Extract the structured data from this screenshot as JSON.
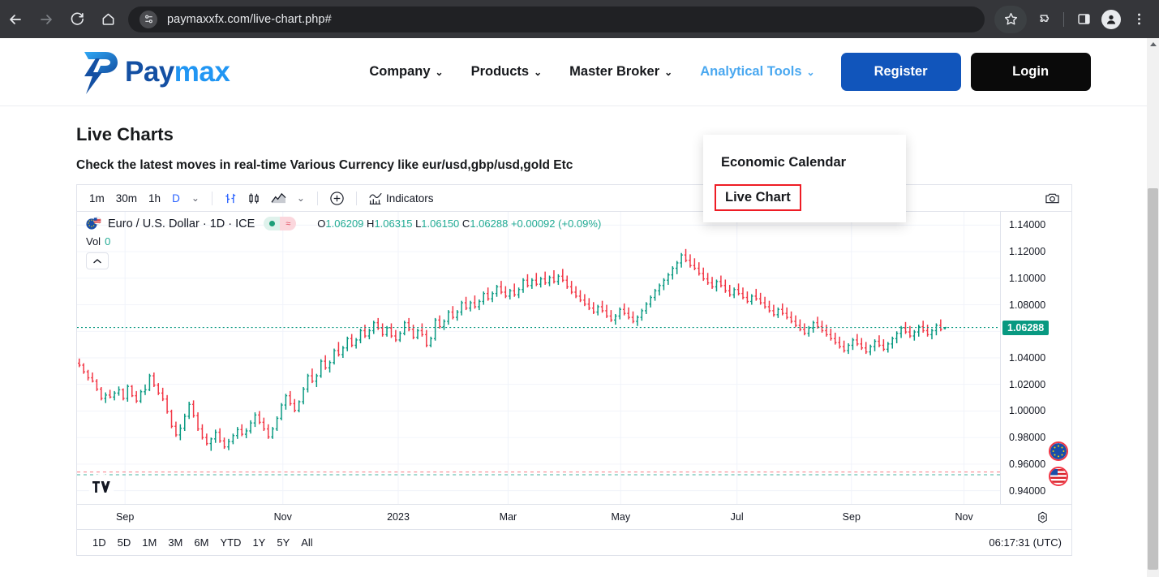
{
  "browser": {
    "back_icon": "back-arrow-icon",
    "forward_icon": "forward-arrow-icon",
    "reload_icon": "reload-icon",
    "home_icon": "home-icon",
    "site_info_icon": "site-settings-icon",
    "url": "paymaxxfx.com/live-chart.php#",
    "bookmark_icon": "star-icon",
    "extensions_icon": "extensions-puzzle-icon",
    "sidepanel_icon": "side-panel-icon",
    "profile_icon": "profile-avatar-icon",
    "menu_icon": "three-dot-menu-icon"
  },
  "site": {
    "logo": {
      "part1": "Pay",
      "part2": "max",
      "mark": "p-lightning-bolt-logo"
    },
    "nav": [
      {
        "label": "Company",
        "active": false
      },
      {
        "label": "Products",
        "active": false
      },
      {
        "label": "Master Broker",
        "active": false
      },
      {
        "label": "Analytical Tools",
        "active": true
      }
    ],
    "caret": "⌄",
    "register_label": "Register",
    "login_label": "Login",
    "register_color": "#1155bb",
    "login_color": "#0a0a0a",
    "active_nav_color": "#4aa8f0"
  },
  "dropdown": {
    "items": [
      {
        "label": "Economic Calendar",
        "highlighted": false
      },
      {
        "label": "Live Chart",
        "highlighted": true
      }
    ],
    "highlight_color": "#ee1c25"
  },
  "page": {
    "title": "Live Charts",
    "subtitle": "Check the latest moves in real-time Various Currency like eur/usd,gbp/usd,gold Etc"
  },
  "chart_widget": {
    "toolbar": {
      "timeframes": [
        {
          "label": "1m",
          "active": false
        },
        {
          "label": "30m",
          "active": false
        },
        {
          "label": "1h",
          "active": false
        },
        {
          "label": "D",
          "active": true
        }
      ],
      "timeframe_caret": "⌄",
      "icons": [
        "bar-series-icon",
        "candle-series-icon",
        "area-series-icon"
      ],
      "series_caret": "⌄",
      "add_icon": "plus-circle-icon",
      "indicators_icon": "indicators-icon",
      "indicators_label": "Indicators",
      "snapshot_icon": "camera-icon"
    },
    "legend": {
      "flag_icon": "eur-usd-flag-icon",
      "symbol": "Euro / U.S. Dollar · 1D · ICE",
      "status_dot_icon": "market-open-dot-icon",
      "status_wave_icon": "delayed-data-icon",
      "ohlc": {
        "o_label": "O",
        "o": "1.06209",
        "h_label": "H",
        "h": "1.06315",
        "l_label": "L",
        "l": "1.06150",
        "c_label": "C",
        "c": "1.06288",
        "change": "+0.00092",
        "change_pct": "(+0.09%)"
      },
      "volume_label": "Vol",
      "volume_value": "0",
      "collapse_icon": "chevron-up-icon"
    },
    "range_bar": {
      "ranges": [
        "1D",
        "5D",
        "1M",
        "3M",
        "6M",
        "YTD",
        "1Y",
        "5Y",
        "All"
      ],
      "clock": "06:17:31 (UTC)"
    },
    "badges": {
      "eu_flag_icon": "eu-flag-badge-icon",
      "us_flag_icon": "us-flag-badge-icon",
      "tv_logo_icon": "tradingview-logo-icon",
      "gear_icon": "axis-settings-gear-icon"
    }
  },
  "chart_data": {
    "type": "candlestick",
    "title": "Euro / U.S. Dollar · 1D · ICE",
    "xlabel": "",
    "ylabel": "",
    "ylim": [
      0.93,
      1.15
    ],
    "grid": true,
    "legend_position": "top-left",
    "up_color": "#089981",
    "down_color": "#f23645",
    "price_ticks": [
      "1.14000",
      "1.12000",
      "1.10000",
      "1.08000",
      "1.06000",
      "1.04000",
      "1.02000",
      "1.00000",
      "0.98000",
      "0.96000",
      "0.94000"
    ],
    "price_tick_values": [
      1.14,
      1.12,
      1.1,
      1.08,
      1.06,
      1.04,
      1.02,
      1.0,
      0.98,
      0.96,
      0.94
    ],
    "current_price": "1.06288",
    "current_price_value": 1.06288,
    "time_ticks": [
      "Sep",
      "Nov",
      "2023",
      "Mar",
      "May",
      "Jul",
      "Sep",
      "Nov"
    ],
    "time_tick_positions": [
      0.052,
      0.223,
      0.348,
      0.467,
      0.589,
      0.715,
      0.839,
      0.961
    ],
    "ohlc": [
      [
        1.036,
        1.0395,
        1.033,
        1.0345
      ],
      [
        1.0345,
        1.036,
        1.028,
        1.0295
      ],
      [
        1.0295,
        1.031,
        1.023,
        1.025
      ],
      [
        1.025,
        1.029,
        1.0215,
        1.0225
      ],
      [
        1.0225,
        1.024,
        1.015,
        1.0165
      ],
      [
        1.0165,
        1.018,
        1.008,
        1.0095
      ],
      [
        1.0095,
        1.014,
        1.006,
        1.012
      ],
      [
        1.012,
        1.016,
        1.0095,
        1.0105
      ],
      [
        1.0105,
        1.015,
        1.008,
        1.0135
      ],
      [
        1.0135,
        1.0185,
        1.0115,
        1.016
      ],
      [
        1.016,
        1.017,
        1.008,
        1.0095
      ],
      [
        1.0095,
        1.02,
        1.007,
        1.0185
      ],
      [
        1.0185,
        1.0195,
        1.0105,
        1.0115
      ],
      [
        1.0115,
        1.015,
        1.006,
        1.0075
      ],
      [
        1.0075,
        1.016,
        1.006,
        1.0145
      ],
      [
        1.0145,
        1.02,
        1.012,
        1.016
      ],
      [
        1.016,
        1.028,
        1.015,
        1.0265
      ],
      [
        1.0265,
        1.029,
        1.018,
        1.0195
      ],
      [
        1.0195,
        1.021,
        1.012,
        1.0135
      ],
      [
        1.0135,
        1.0175,
        1.0075,
        1.009
      ],
      [
        1.009,
        1.012,
        0.998,
        0.9995
      ],
      [
        0.9995,
        1.001,
        0.987,
        0.9885
      ],
      [
        0.9885,
        0.992,
        0.9805,
        0.982
      ],
      [
        0.982,
        0.99,
        0.978,
        0.987
      ],
      [
        0.987,
        0.998,
        0.985,
        0.996
      ],
      [
        0.996,
        1.007,
        0.994,
        1.005
      ],
      [
        1.005,
        1.008,
        0.995,
        0.9965
      ],
      [
        0.9965,
        0.999,
        0.985,
        0.9865
      ],
      [
        0.9865,
        0.99,
        0.9785,
        0.98
      ],
      [
        0.98,
        0.983,
        0.974,
        0.9755
      ],
      [
        0.9755,
        0.98,
        0.97,
        0.979
      ],
      [
        0.979,
        0.986,
        0.976,
        0.984
      ],
      [
        0.984,
        0.987,
        0.976,
        0.9775
      ],
      [
        0.9775,
        0.98,
        0.9715,
        0.973
      ],
      [
        0.973,
        0.979,
        0.9705,
        0.977
      ],
      [
        0.977,
        0.983,
        0.975,
        0.9815
      ],
      [
        0.9815,
        0.988,
        0.979,
        0.986
      ],
      [
        0.986,
        0.99,
        0.981,
        0.9825
      ],
      [
        0.9825,
        0.987,
        0.9795,
        0.985
      ],
      [
        0.985,
        0.993,
        0.983,
        0.991
      ],
      [
        0.991,
        0.999,
        0.988,
        0.997
      ],
      [
        0.997,
        1.0,
        0.99,
        0.9915
      ],
      [
        0.9915,
        0.995,
        0.985,
        0.9865
      ],
      [
        0.9865,
        0.99,
        0.979,
        0.9805
      ],
      [
        0.9805,
        0.988,
        0.979,
        0.9865
      ],
      [
        0.9865,
        0.996,
        0.985,
        0.9945
      ],
      [
        0.9945,
        1.006,
        0.993,
        1.0045
      ],
      [
        1.0045,
        1.013,
        1.001,
        1.0115
      ],
      [
        1.0115,
        1.015,
        1.004,
        1.0055
      ],
      [
        1.0055,
        1.009,
        0.999,
        1.0005
      ],
      [
        1.0005,
        1.008,
        0.999,
        1.007
      ],
      [
        1.007,
        1.018,
        1.005,
        1.0165
      ],
      [
        1.0165,
        1.028,
        1.014,
        1.0265
      ],
      [
        1.0265,
        1.032,
        1.021,
        1.0225
      ],
      [
        1.0225,
        1.028,
        1.018,
        1.0265
      ],
      [
        1.0265,
        1.039,
        1.025,
        1.0375
      ],
      [
        1.0375,
        1.042,
        1.031,
        1.0325
      ],
      [
        1.0325,
        1.038,
        1.029,
        1.0365
      ],
      [
        1.0365,
        1.047,
        1.035,
        1.0455
      ],
      [
        1.0455,
        1.052,
        1.041,
        1.0425
      ],
      [
        1.0425,
        1.049,
        1.04,
        1.0475
      ],
      [
        1.0475,
        1.056,
        1.045,
        1.0545
      ],
      [
        1.0545,
        1.058,
        1.048,
        1.0495
      ],
      [
        1.0495,
        1.055,
        1.047,
        1.0535
      ],
      [
        1.0535,
        1.062,
        1.051,
        1.0605
      ],
      [
        1.0605,
        1.065,
        1.055,
        1.0565
      ],
      [
        1.0565,
        1.062,
        1.054,
        1.0605
      ],
      [
        1.0605,
        1.068,
        1.058,
        1.0665
      ],
      [
        1.0665,
        1.07,
        1.061,
        1.0625
      ],
      [
        1.0625,
        1.066,
        1.056,
        1.0575
      ],
      [
        1.0575,
        1.064,
        1.056,
        1.0625
      ],
      [
        1.0625,
        1.066,
        1.055,
        1.0565
      ],
      [
        1.0565,
        1.061,
        1.052,
        1.0535
      ],
      [
        1.0535,
        1.06,
        1.052,
        1.0585
      ],
      [
        1.0585,
        1.068,
        1.057,
        1.0665
      ],
      [
        1.0665,
        1.07,
        1.06,
        1.0615
      ],
      [
        1.0615,
        1.065,
        1.054,
        1.0555
      ],
      [
        1.0555,
        1.062,
        1.054,
        1.0605
      ],
      [
        1.0605,
        1.066,
        1.056,
        1.0575
      ],
      [
        1.0575,
        1.061,
        1.048,
        1.0495
      ],
      [
        1.0495,
        1.056,
        1.048,
        1.0545
      ],
      [
        1.0545,
        1.07,
        1.053,
        1.0685
      ],
      [
        1.0685,
        1.072,
        1.062,
        1.0635
      ],
      [
        1.0635,
        1.069,
        1.061,
        1.0675
      ],
      [
        1.0675,
        1.076,
        1.065,
        1.0745
      ],
      [
        1.0745,
        1.079,
        1.069,
        1.0705
      ],
      [
        1.0705,
        1.076,
        1.068,
        1.0745
      ],
      [
        1.0745,
        1.083,
        1.072,
        1.0815
      ],
      [
        1.0815,
        1.086,
        1.076,
        1.0775
      ],
      [
        1.0775,
        1.083,
        1.075,
        1.0815
      ],
      [
        1.0815,
        1.087,
        1.077,
        1.0785
      ],
      [
        1.0785,
        1.084,
        1.076,
        1.0825
      ],
      [
        1.0825,
        1.09,
        1.08,
        1.0885
      ],
      [
        1.0885,
        1.093,
        1.083,
        1.0845
      ],
      [
        1.0845,
        1.09,
        1.082,
        1.0885
      ],
      [
        1.0885,
        1.095,
        1.086,
        1.0935
      ],
      [
        1.0935,
        1.098,
        1.088,
        1.0895
      ],
      [
        1.0895,
        1.094,
        1.085,
        1.0865
      ],
      [
        1.0865,
        1.092,
        1.084,
        1.0905
      ],
      [
        1.0905,
        1.096,
        1.086,
        1.0875
      ],
      [
        1.0875,
        1.093,
        1.085,
        1.0915
      ],
      [
        1.0915,
        1.1,
        1.089,
        1.0985
      ],
      [
        1.0985,
        1.103,
        1.093,
        1.0945
      ],
      [
        1.0945,
        1.1,
        1.092,
        1.0985
      ],
      [
        1.0985,
        1.104,
        1.094,
        1.0955
      ],
      [
        1.0955,
        1.101,
        1.093,
        1.0995
      ],
      [
        1.0995,
        1.105,
        1.095,
        1.0965
      ],
      [
        1.0965,
        1.102,
        1.094,
        1.1005
      ],
      [
        1.1005,
        1.106,
        1.096,
        1.0975
      ],
      [
        1.0975,
        1.103,
        1.095,
        1.1015
      ],
      [
        1.1015,
        1.107,
        1.097,
        1.0985
      ],
      [
        1.0985,
        1.102,
        1.092,
        1.0935
      ],
      [
        1.0935,
        1.098,
        1.088,
        1.0895
      ],
      [
        1.0895,
        1.094,
        1.085,
        1.0865
      ],
      [
        1.0865,
        1.091,
        1.082,
        1.0835
      ],
      [
        1.0835,
        1.088,
        1.079,
        1.0805
      ],
      [
        1.0805,
        1.085,
        1.076,
        1.0775
      ],
      [
        1.0775,
        1.082,
        1.073,
        1.0745
      ],
      [
        1.0745,
        1.08,
        1.072,
        1.0785
      ],
      [
        1.0785,
        1.083,
        1.074,
        1.0755
      ],
      [
        1.0755,
        1.08,
        1.07,
        1.0715
      ],
      [
        1.0715,
        1.076,
        1.067,
        1.0685
      ],
      [
        1.0685,
        1.073,
        1.065,
        1.0715
      ],
      [
        1.0715,
        1.078,
        1.069,
        1.0765
      ],
      [
        1.0765,
        1.081,
        1.072,
        1.0735
      ],
      [
        1.0735,
        1.078,
        1.069,
        1.0705
      ],
      [
        1.0705,
        1.075,
        1.066,
        1.0675
      ],
      [
        1.0675,
        1.072,
        1.064,
        1.0705
      ],
      [
        1.0705,
        1.077,
        1.068,
        1.0755
      ],
      [
        1.0755,
        1.082,
        1.073,
        1.0805
      ],
      [
        1.0805,
        1.087,
        1.078,
        1.0855
      ],
      [
        1.0855,
        1.092,
        1.083,
        1.0905
      ],
      [
        1.0905,
        1.096,
        1.087,
        1.0945
      ],
      [
        1.0945,
        1.1,
        1.091,
        1.0985
      ],
      [
        1.0985,
        1.104,
        1.095,
        1.1025
      ],
      [
        1.1025,
        1.109,
        1.099,
        1.1075
      ],
      [
        1.1075,
        1.113,
        1.103,
        1.1115
      ],
      [
        1.1115,
        1.119,
        1.108,
        1.1175
      ],
      [
        1.1175,
        1.122,
        1.112,
        1.1135
      ],
      [
        1.1135,
        1.118,
        1.108,
        1.1095
      ],
      [
        1.1095,
        1.115,
        1.106,
        1.1075
      ],
      [
        1.1075,
        1.112,
        1.102,
        1.1035
      ],
      [
        1.1035,
        1.108,
        1.098,
        1.0995
      ],
      [
        1.0995,
        1.104,
        1.095,
        1.0965
      ],
      [
        1.0965,
        1.101,
        1.092,
        1.0935
      ],
      [
        1.0935,
        1.099,
        1.09,
        1.0975
      ],
      [
        1.0975,
        1.102,
        1.093,
        1.0945
      ],
      [
        1.0945,
        1.099,
        1.089,
        1.0905
      ],
      [
        1.0905,
        1.095,
        1.086,
        1.0875
      ],
      [
        1.0875,
        1.093,
        1.085,
        1.0915
      ],
      [
        1.0915,
        1.096,
        1.087,
        1.0885
      ],
      [
        1.0885,
        1.093,
        1.084,
        1.0855
      ],
      [
        1.0855,
        1.09,
        1.081,
        1.0825
      ],
      [
        1.0825,
        1.088,
        1.08,
        1.0865
      ],
      [
        1.0865,
        1.092,
        1.083,
        1.0845
      ],
      [
        1.0845,
        1.089,
        1.08,
        1.0815
      ],
      [
        1.0815,
        1.086,
        1.077,
        1.0785
      ],
      [
        1.0785,
        1.083,
        1.074,
        1.0755
      ],
      [
        1.0755,
        1.08,
        1.071,
        1.0725
      ],
      [
        1.0725,
        1.078,
        1.07,
        1.0765
      ],
      [
        1.0765,
        1.081,
        1.072,
        1.0735
      ],
      [
        1.0735,
        1.078,
        1.069,
        1.0705
      ],
      [
        1.0705,
        1.075,
        1.066,
        1.0675
      ],
      [
        1.0675,
        1.072,
        1.063,
        1.0645
      ],
      [
        1.0645,
        1.069,
        1.06,
        1.0615
      ],
      [
        1.0615,
        1.066,
        1.057,
        1.0585
      ],
      [
        1.0585,
        1.064,
        1.056,
        1.0625
      ],
      [
        1.0625,
        1.068,
        1.059,
        1.0665
      ],
      [
        1.0665,
        1.071,
        1.062,
        1.0635
      ],
      [
        1.0635,
        1.068,
        1.059,
        1.0605
      ],
      [
        1.0605,
        1.065,
        1.056,
        1.0575
      ],
      [
        1.0575,
        1.062,
        1.053,
        1.0545
      ],
      [
        1.0545,
        1.059,
        1.05,
        1.0515
      ],
      [
        1.0515,
        1.056,
        1.047,
        1.0485
      ],
      [
        1.0485,
        1.053,
        1.044,
        1.0455
      ],
      [
        1.0455,
        1.051,
        1.043,
        1.0495
      ],
      [
        1.0495,
        1.055,
        1.046,
        1.0535
      ],
      [
        1.0535,
        1.058,
        1.049,
        1.0505
      ],
      [
        1.0505,
        1.055,
        1.046,
        1.0475
      ],
      [
        1.0475,
        1.052,
        1.043,
        1.0445
      ],
      [
        1.0445,
        1.05,
        1.042,
        1.0485
      ],
      [
        1.0485,
        1.054,
        1.045,
        1.0525
      ],
      [
        1.0525,
        1.057,
        1.048,
        1.0495
      ],
      [
        1.0495,
        1.054,
        1.045,
        1.0465
      ],
      [
        1.0465,
        1.052,
        1.044,
        1.0505
      ],
      [
        1.0505,
        1.056,
        1.047,
        1.0545
      ],
      [
        1.0545,
        1.06,
        1.051,
        1.0585
      ],
      [
        1.0585,
        1.064,
        1.055,
        1.0625
      ],
      [
        1.0625,
        1.067,
        1.058,
        1.0595
      ],
      [
        1.0595,
        1.064,
        1.055,
        1.0565
      ],
      [
        1.0565,
        1.061,
        1.053,
        1.0595
      ],
      [
        1.0595,
        1.065,
        1.056,
        1.0635
      ],
      [
        1.0635,
        1.068,
        1.059,
        1.0605
      ],
      [
        1.0605,
        1.065,
        1.056,
        1.0575
      ],
      [
        1.0575,
        1.062,
        1.054,
        1.0605
      ],
      [
        1.0605,
        1.066,
        1.057,
        1.0645
      ],
      [
        1.0645,
        1.069,
        1.06,
        1.0615
      ],
      [
        1.06209,
        1.06315,
        1.0615,
        1.06288
      ]
    ]
  }
}
